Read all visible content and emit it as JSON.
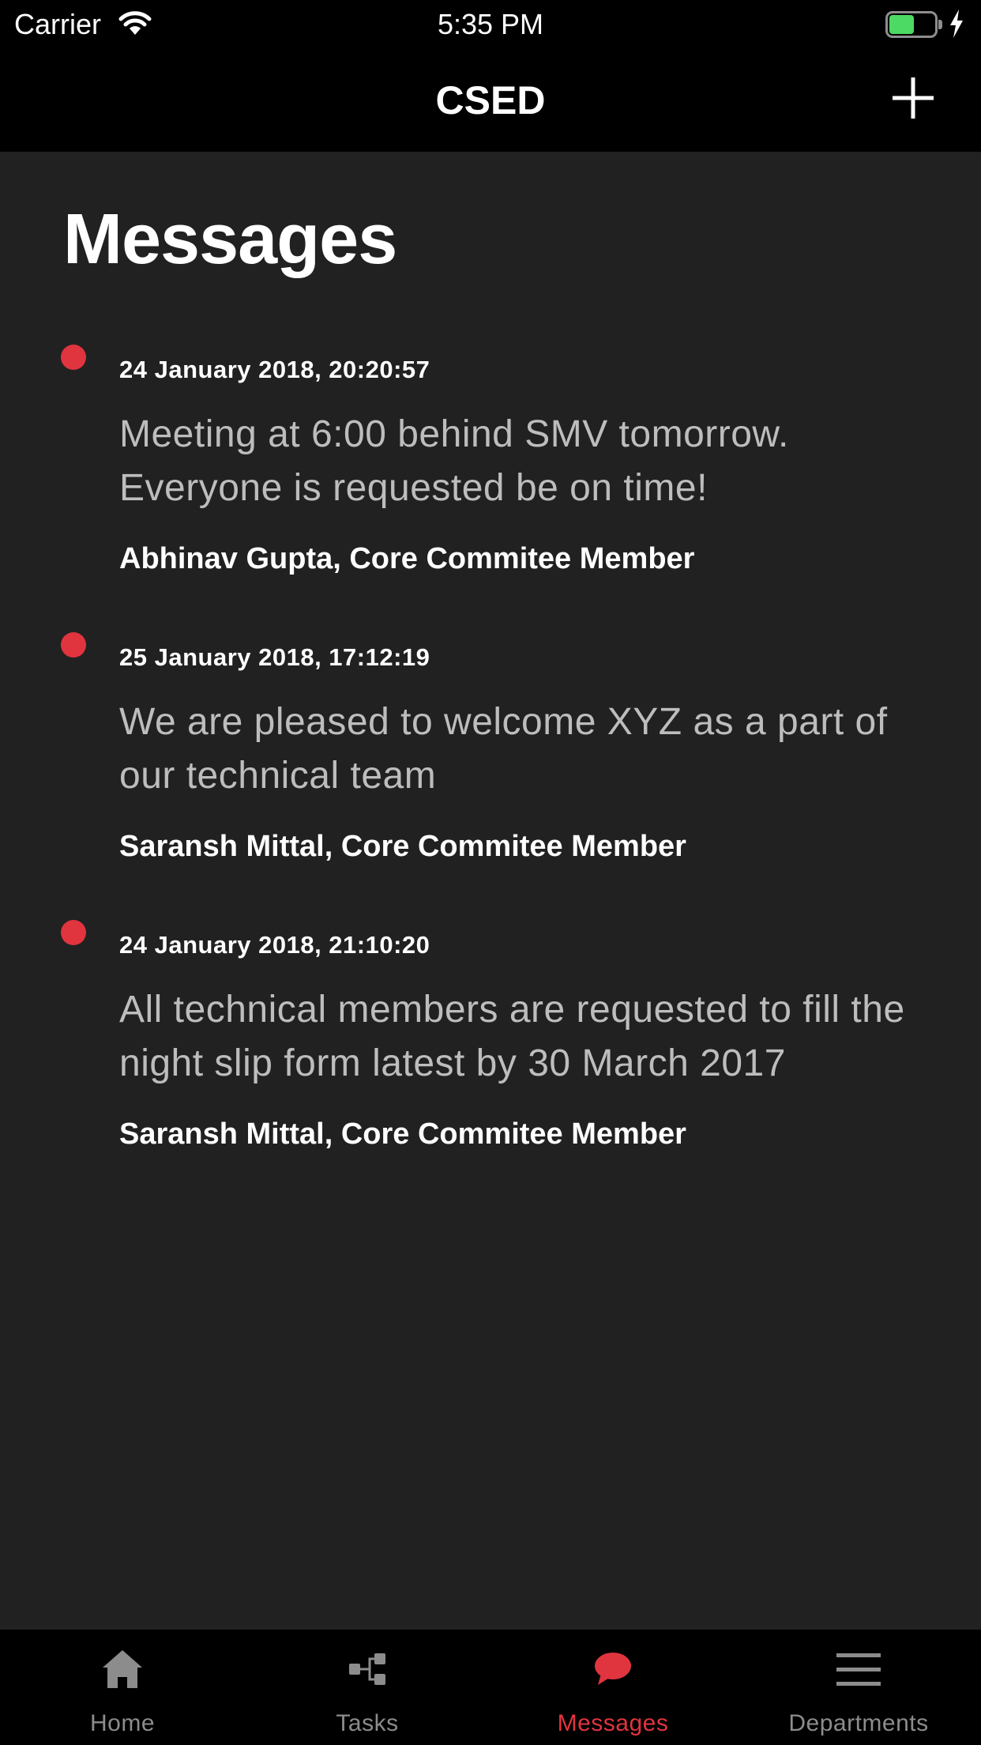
{
  "status_bar": {
    "carrier": "Carrier",
    "time": "5:35 PM",
    "battery_level": 0.55
  },
  "nav": {
    "title": "CSED",
    "add_icon": "plus-icon"
  },
  "page": {
    "title": "Messages"
  },
  "messages": [
    {
      "date": "24 January 2018, 20:20:57",
      "text": "Meeting at 6:00 behind SMV tomorrow. Everyone is requested be on time!",
      "author": "Abhinav Gupta, Core Commitee Member"
    },
    {
      "date": "25 January 2018, 17:12:19",
      "text": "We are pleased to welcome XYZ as a part of our technical team",
      "author": "Saransh Mittal, Core Commitee Member"
    },
    {
      "date": "24 January 2018, 21:10:20",
      "text": "All technical members are requested to fill the night slip form latest by 30 March 2017",
      "author": "Saransh Mittal, Core Commitee Member"
    }
  ],
  "tabs": [
    {
      "label": "Home",
      "icon": "home-icon",
      "active": false
    },
    {
      "label": "Tasks",
      "icon": "tasks-icon",
      "active": false
    },
    {
      "label": "Messages",
      "icon": "messages-icon",
      "active": true
    },
    {
      "label": "Departments",
      "icon": "menu-icon",
      "active": false
    }
  ],
  "colors": {
    "accent": "#e0343f",
    "background": "#212121",
    "bar": "#000000"
  }
}
